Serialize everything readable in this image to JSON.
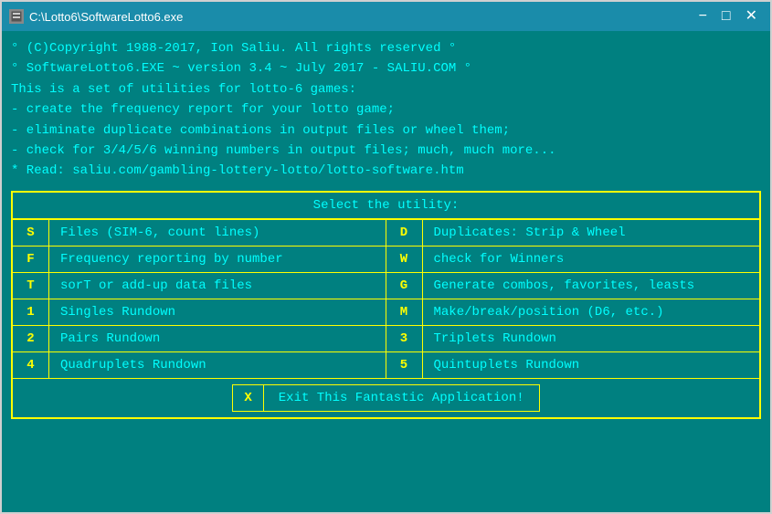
{
  "window": {
    "title": "C:\\Lotto6\\SoftwareLotto6.exe",
    "minimize_label": "−",
    "maximize_label": "□",
    "close_label": "✕"
  },
  "info": {
    "line1": "° (C)Copyright 1988-2017, Ion Saliu. All rights reserved °",
    "line2": "° SoftwareLotto6.EXE ~ version 3.4 ~ July 2017 - SALIU.COM °",
    "line3": "This is a set of utilities for lotto-6 games:",
    "line4": "  - create the frequency report for your lotto game;",
    "line5": "  - eliminate duplicate combinations in output files or wheel them;",
    "line6": "  - check for 3/4/5/6 winning numbers in output files; much, much more...",
    "line7": "* Read: saliu.com/gambling-lottery-lotto/lotto-software.htm"
  },
  "table": {
    "header": "Select the utility:",
    "rows": [
      {
        "left_key": "S",
        "left_label": "Files (SIM-6, count lines)",
        "right_key": "D",
        "right_label": "Duplicates: Strip & Wheel"
      },
      {
        "left_key": "F",
        "left_label": "Frequency reporting by number",
        "right_key": "W",
        "right_label": "check for Winners"
      },
      {
        "left_key": "T",
        "left_label": "sorT or add-up data files",
        "right_key": "G",
        "right_label": "Generate combos, favorites, leasts"
      },
      {
        "left_key": "1",
        "left_label": "Singles Rundown",
        "right_key": "M",
        "right_label": "Make/break/position (D6, etc.)"
      },
      {
        "left_key": "2",
        "left_label": "Pairs Rundown",
        "right_key": "3",
        "right_label": "Triplets Rundown"
      },
      {
        "left_key": "4",
        "left_label": "Quadruplets Rundown",
        "right_key": "5",
        "right_label": "Quintuplets Rundown"
      }
    ],
    "exit_key": "X",
    "exit_label": "Exit This Fantastic Application!"
  }
}
